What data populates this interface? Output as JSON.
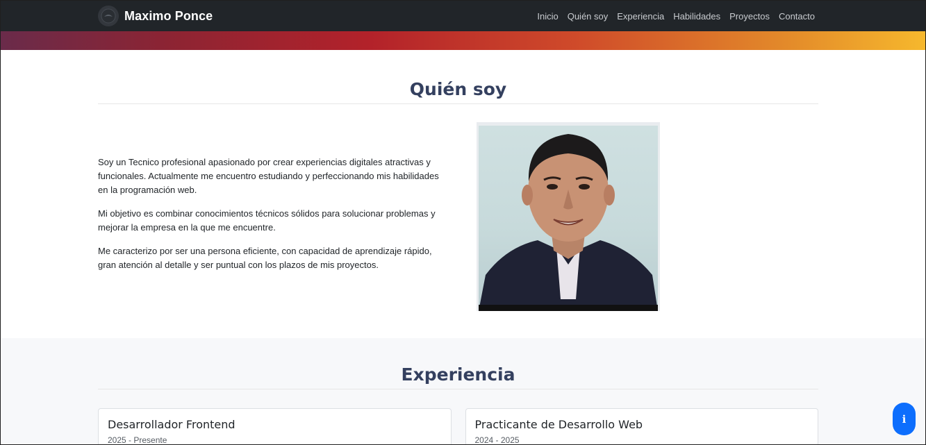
{
  "navbar": {
    "brand": "Maximo Ponce",
    "links": [
      "Inicio",
      "Quién soy",
      "Experiencia",
      "Habilidades",
      "Proyectos",
      "Contacto"
    ]
  },
  "about": {
    "title": "Quién soy",
    "paragraphs": [
      "Soy un Tecnico profesional apasionado por crear experiencias digitales atractivas y funcionales. Actualmente me encuentro estudiando y perfeccionando mis habilidades en la programación web.",
      "Mi objetivo es combinar conocimientos técnicos sólidos para solucionar problemas y mejorar la empresa en la que me encuentre.",
      "Me caracterizo por ser una persona eficiente, con capacidad de aprendizaje rápido, gran atención al detalle y ser puntual con los plazos de mis proyectos."
    ]
  },
  "experience": {
    "title": "Experiencia",
    "items": [
      {
        "role": "Desarrollador Frontend",
        "period": "2025 - Presente"
      },
      {
        "role": "Practicante de Desarrollo Web",
        "period": "2024 - 2025"
      }
    ]
  },
  "info_button": {
    "label": "i"
  },
  "colors": {
    "navbar_bg": "#212529",
    "title": "#34405f",
    "accent_button": "#0d6efd"
  }
}
